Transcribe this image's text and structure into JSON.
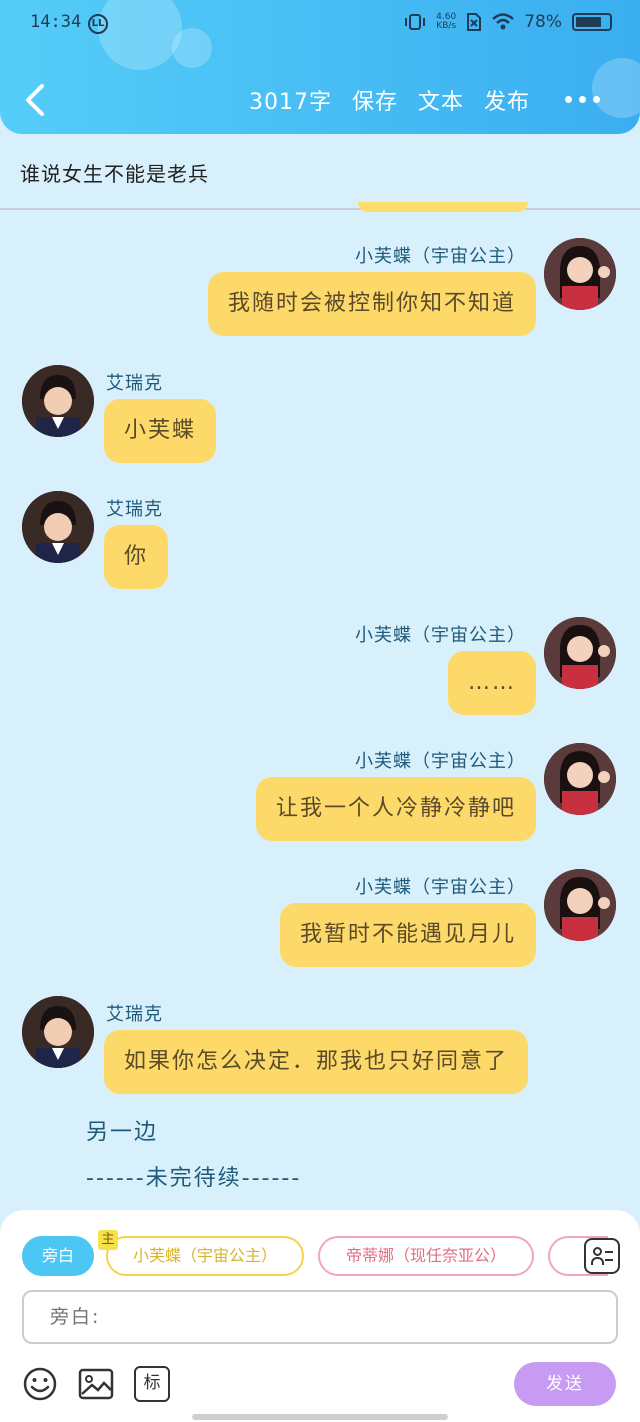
{
  "status_bar": {
    "time": "14:34",
    "ll": "LL",
    "net_speed_value": "4.60",
    "net_speed_unit": "KB/s",
    "battery": "78%",
    "battery_level": 0.78
  },
  "header": {
    "word_count": "3017字",
    "save": "保存",
    "text": "文本",
    "publish": "发布",
    "back_icon": "chevron-left-icon",
    "more_icon": "more-horizontal-icon"
  },
  "story_title": "谁说女生不能是老兵",
  "messages": [
    {
      "side": "right",
      "name": "小芙蝶（宇宙公主）",
      "text": "我随时会被控制你知不知道"
    },
    {
      "side": "left",
      "name": "艾瑞克",
      "text": "小芙蝶"
    },
    {
      "side": "left",
      "name": "艾瑞克",
      "text": "你"
    },
    {
      "side": "right",
      "name": "小芙蝶（宇宙公主）",
      "text": "……"
    },
    {
      "side": "right",
      "name": "小芙蝶（宇宙公主）",
      "text": "让我一个人冷静冷静吧"
    },
    {
      "side": "right",
      "name": "小芙蝶（宇宙公主）",
      "text": "我暂时不能遇见月儿"
    },
    {
      "side": "left",
      "name": "艾瑞克",
      "text": "如果你怎么决定．那我也只好同意了"
    }
  ],
  "narration": [
    "另一边",
    "------未完待续------"
  ],
  "composer": {
    "characters": [
      {
        "label": "旁白"
      },
      {
        "label": "小芙蝶（宇宙公主）",
        "tag": "主"
      },
      {
        "label": "帝蒂娜（现任奈亚公）"
      }
    ],
    "input_placeholder": "旁白:",
    "send": "发送",
    "tools": [
      "emoji-icon",
      "image-icon",
      "标"
    ],
    "contacts_icon": "contact-card-icon"
  },
  "colors": {
    "header": "#3aaef0",
    "bubble": "#fdd96a",
    "background": "#d8f0fb",
    "send": "#c79bf2"
  }
}
